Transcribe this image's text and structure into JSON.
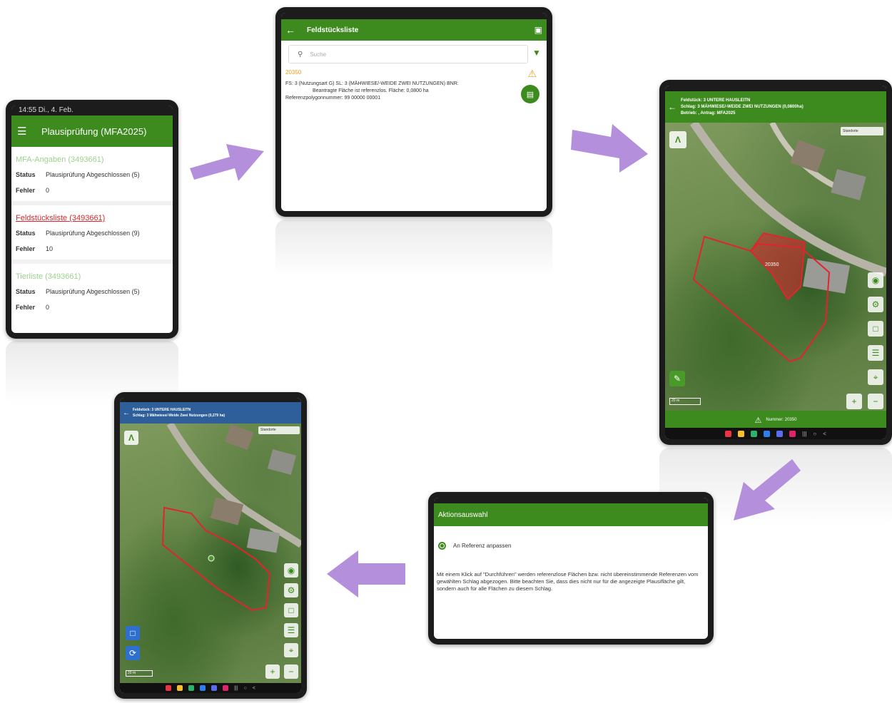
{
  "panel1": {
    "status_time": "14:55  Di., 4. Feb.",
    "title": "Plausiprüfung (MFA2025)",
    "sections": [
      {
        "title": "MFA-Angaben  (3493661)",
        "status_label": "Status",
        "status_value": "Plausiprüfung Abgeschlossen (5)",
        "error_label": "Fehler",
        "error_value": "0"
      },
      {
        "title": "Feldstücksliste  (3493661)",
        "status_label": "Status",
        "status_value": "Plausiprüfung Abgeschlossen (9)",
        "error_label": "Fehler",
        "error_value": "10"
      },
      {
        "title": "Tierliste  (3493661)",
        "status_label": "Status",
        "status_value": "Plausiprüfung Abgeschlossen (5)",
        "error_label": "Fehler",
        "error_value": "0"
      }
    ]
  },
  "panel2": {
    "title": "Feldstücksliste",
    "search_placeholder": "Suche",
    "item_number": "20350",
    "item_line1": "FS: 3 (Nutzungsart G) SL: 3 (MÄHWIESE/-WEIDE ZWEI NUTZUNGEN) BNR:",
    "item_line2": "Beantragte Fläche ist referenzlos. Fläche: 0,0800 ha",
    "item_line3": "Referenzpolygonnummer: 99 00000 00001"
  },
  "panel3": {
    "header_line1": "Feldstück: 3 UNTERE HAUSLEITN",
    "header_line2": "Schlag: 3 MÄHWIESE/-WEIDE ZWEI NUTZUNGEN (0,0800ha)",
    "header_line3": "Betrieb: , Antrag: MFA2025",
    "legend_label": "Standorte",
    "scale": "20 m",
    "polygon_label": "20350",
    "bottom_label": "Nummer: 20350"
  },
  "panel4": {
    "title": "Aktionsauswahl",
    "option_label": "An Referenz anpassen",
    "description": "Mit einem Klick auf \"Durchführen\" werden referenzlose Flächen bzw. nicht übereinstimmende Referenzen vom gewählten Schlag abgezogen. Bitte beachten Sie, dass dies nicht nur für die angezeigte Plausifläche gilt, sondern auch für alle Flächen zu diesem Schlag."
  },
  "panel5": {
    "header_line1": "Feldstück: 3 UNTERE HAUSLEITN",
    "header_line2": "Schlag: 3 Mähwiese/-Weide Zwei Nutzungen (0,279 ha)",
    "legend_label": "Standorte",
    "scale": "20 m"
  },
  "colors": {
    "green": "#3d8b1e",
    "arrow": "#b48fdc",
    "blue_header": "#2e5f9a",
    "polygon": "#e0252f",
    "warning": "#f0a020",
    "link_red": "#d9262c",
    "light_green_text": "#9bd38a"
  }
}
